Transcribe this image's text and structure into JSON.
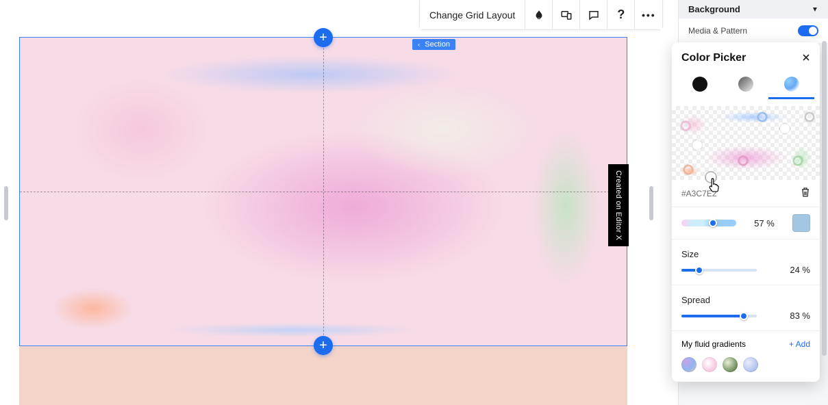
{
  "toolbar": {
    "change_grid_label": "Change Grid Layout"
  },
  "canvas": {
    "section_badge": "Section",
    "editorx_badge": "Created on Editor X"
  },
  "right_panel": {
    "background_title": "Background",
    "media_pattern_label": "Media & Pattern",
    "media_pattern_on": true
  },
  "picker": {
    "title": "Color Picker",
    "hex": "#A3C7E2",
    "opacity_pct": "57 %",
    "size_label": "Size",
    "size_pct": "24 %",
    "spread_label": "Spread",
    "spread_pct": "83 %",
    "saved_label": "My fluid gradients",
    "add_label": "+ Add"
  },
  "sliders": {
    "opacity_fill": 57,
    "size_fill": 24,
    "spread_fill": 83
  }
}
